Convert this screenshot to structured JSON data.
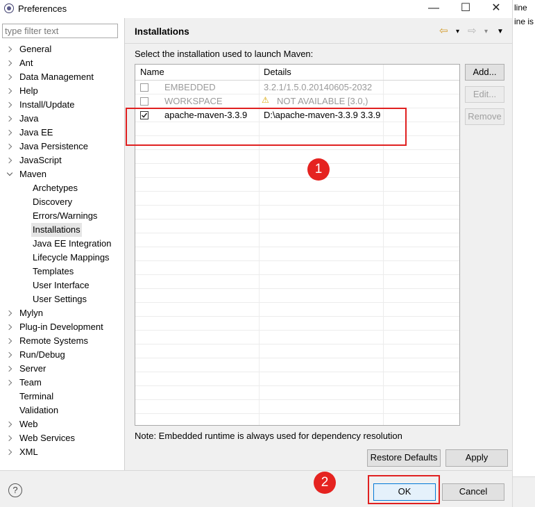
{
  "window": {
    "title": "Preferences",
    "minimize": "—",
    "maximize": "☐",
    "close": "✕"
  },
  "sliver": {
    "line1": "line",
    "line2": "ine is"
  },
  "filter": {
    "placeholder": "type filter text",
    "value": ""
  },
  "tree": [
    {
      "label": "General",
      "kind": "closed",
      "indent": 0
    },
    {
      "label": "Ant",
      "kind": "closed",
      "indent": 0
    },
    {
      "label": "Data Management",
      "kind": "closed",
      "indent": 0
    },
    {
      "label": "Help",
      "kind": "closed",
      "indent": 0
    },
    {
      "label": "Install/Update",
      "kind": "closed",
      "indent": 0
    },
    {
      "label": "Java",
      "kind": "closed",
      "indent": 0
    },
    {
      "label": "Java EE",
      "kind": "closed",
      "indent": 0
    },
    {
      "label": "Java Persistence",
      "kind": "closed",
      "indent": 0
    },
    {
      "label": "JavaScript",
      "kind": "closed",
      "indent": 0
    },
    {
      "label": "Maven",
      "kind": "open",
      "indent": 0
    },
    {
      "label": "Archetypes",
      "kind": "leaf",
      "indent": 1
    },
    {
      "label": "Discovery",
      "kind": "leaf",
      "indent": 1
    },
    {
      "label": "Errors/Warnings",
      "kind": "leaf",
      "indent": 1
    },
    {
      "label": "Installations",
      "kind": "leaf",
      "indent": 1,
      "selected": true
    },
    {
      "label": "Java EE Integration",
      "kind": "leaf",
      "indent": 1
    },
    {
      "label": "Lifecycle Mappings",
      "kind": "leaf",
      "indent": 1
    },
    {
      "label": "Templates",
      "kind": "leaf",
      "indent": 1
    },
    {
      "label": "User Interface",
      "kind": "leaf",
      "indent": 1
    },
    {
      "label": "User Settings",
      "kind": "leaf",
      "indent": 1
    },
    {
      "label": "Mylyn",
      "kind": "closed",
      "indent": 0
    },
    {
      "label": "Plug-in Development",
      "kind": "closed",
      "indent": 0
    },
    {
      "label": "Remote Systems",
      "kind": "closed",
      "indent": 0
    },
    {
      "label": "Run/Debug",
      "kind": "closed",
      "indent": 0
    },
    {
      "label": "Server",
      "kind": "closed",
      "indent": 0
    },
    {
      "label": "Team",
      "kind": "closed",
      "indent": 0
    },
    {
      "label": "Terminal",
      "kind": "leaf",
      "indent": 0
    },
    {
      "label": "Validation",
      "kind": "leaf",
      "indent": 0
    },
    {
      "label": "Web",
      "kind": "closed",
      "indent": 0
    },
    {
      "label": "Web Services",
      "kind": "closed",
      "indent": 0
    },
    {
      "label": "XML",
      "kind": "closed",
      "indent": 0
    }
  ],
  "page": {
    "title": "Installations",
    "subtitle": "Select the installation used to launch Maven:",
    "note": "Note: Embedded runtime is always used for dependency resolution"
  },
  "table": {
    "columns": [
      "Name",
      "Details"
    ],
    "rows": [
      {
        "name": "EMBEDDED",
        "details": "3.2.1/1.5.0.20140605-2032",
        "checked": false,
        "disabled": true,
        "warning": false
      },
      {
        "name": "WORKSPACE",
        "details": "NOT AVAILABLE [3.0,)",
        "checked": false,
        "disabled": true,
        "warning": true
      },
      {
        "name": "apache-maven-3.3.9",
        "details": "D:\\apache-maven-3.3.9 3.3.9",
        "checked": true,
        "disabled": false,
        "warning": false
      }
    ]
  },
  "buttons": {
    "add": "Add...",
    "edit": "Edit...",
    "remove": "Remove",
    "restore_defaults": "Restore Defaults",
    "apply": "Apply",
    "ok": "OK",
    "cancel": "Cancel"
  },
  "markers": {
    "one": "1",
    "two": "2"
  },
  "icons": {
    "help": "?",
    "back": "⇦",
    "forward": "⇨",
    "dropdown": "▾",
    "menu": "▼",
    "warning": "⚠"
  },
  "colors": {
    "marker": "#e52320"
  }
}
